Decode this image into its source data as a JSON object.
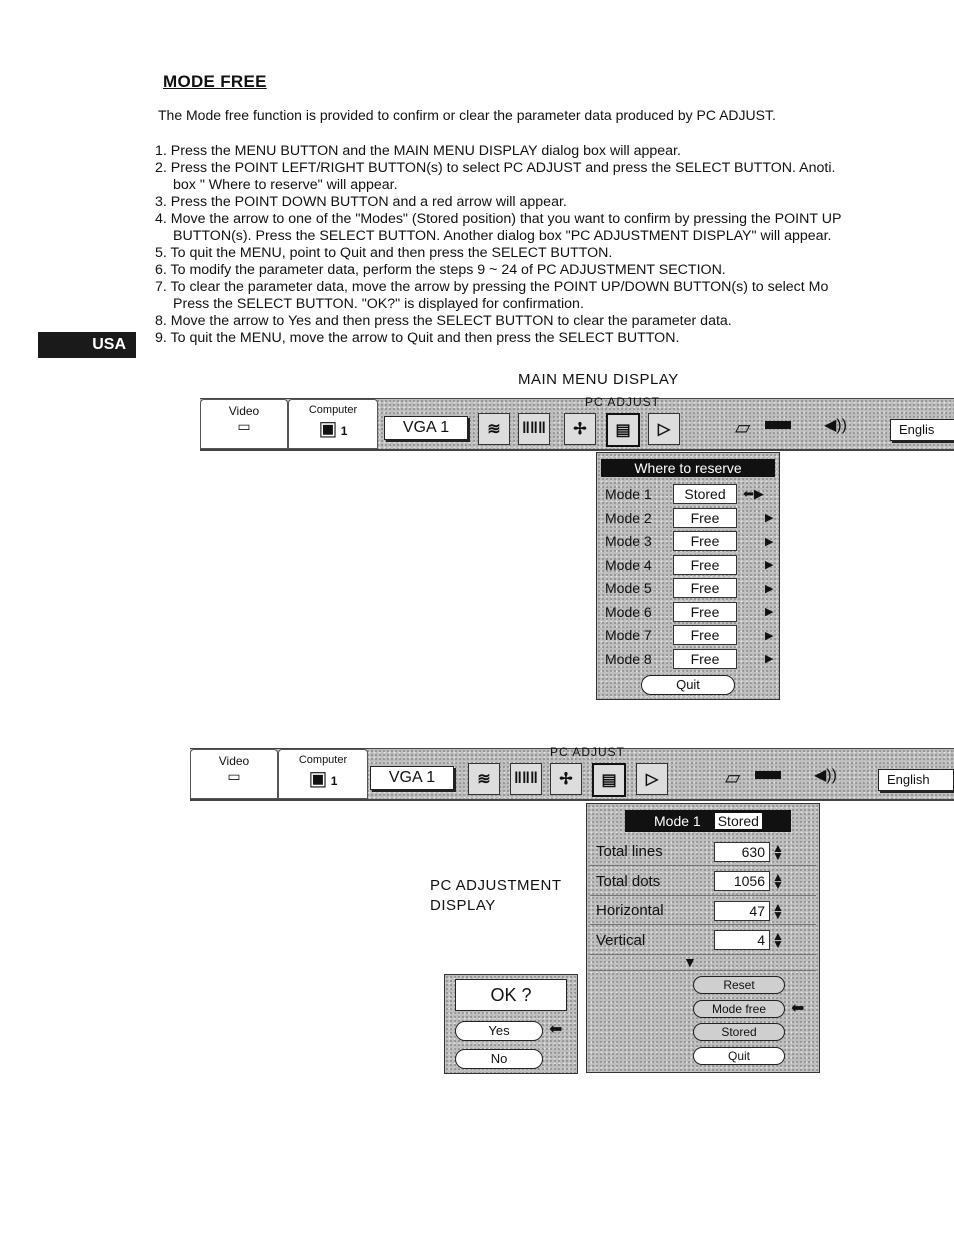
{
  "section": {
    "title": "MODE FREE",
    "intro": "The Mode free function is provided to confirm or clear the parameter data produced by PC ADJUST.",
    "steps": [
      {
        "num": "1.",
        "lines": [
          "Press the MENU BUTTON and the MAIN MENU DISPLAY dialog box will appear."
        ]
      },
      {
        "num": "2.",
        "lines": [
          "Press the POINT LEFT/RIGHT BUTTON(s) to select PC ADJUST and press the SELECT BUTTON. Anoti.",
          "box \" Where to reserve\" will appear."
        ]
      },
      {
        "num": "3.",
        "lines": [
          "Press the POINT DOWN BUTTON and a red arrow will appear."
        ]
      },
      {
        "num": "4.",
        "lines": [
          "Move the arrow to one of the \"Modes\" (Stored position) that you want to confirm by pressing the POINT UP",
          "BUTTON(s). Press the SELECT BUTTON. Another dialog box \"PC ADJUSTMENT DISPLAY\" will appear."
        ]
      },
      {
        "num": "5.",
        "lines": [
          "To quit the MENU, point to Quit and then press the SELECT BUTTON."
        ]
      },
      {
        "num": "6.",
        "lines": [
          "To modify the parameter data, perform the steps 9 ~ 24 of PC ADJUSTMENT SECTION."
        ]
      },
      {
        "num": "7.",
        "lines": [
          "To clear the parameter data, move the arrow by pressing the POINT UP/DOWN BUTTON(s) to select Mo",
          "Press the SELECT BUTTON. \"OK?\" is displayed for confirmation."
        ]
      },
      {
        "num": "8.",
        "lines": [
          "Move the arrow to Yes and then press the SELECT BUTTON to clear the parameter data."
        ]
      },
      {
        "num": "9.",
        "lines": [
          "To quit the MENU, move the arrow to Quit and then press the SELECT BUTTON."
        ]
      }
    ]
  },
  "side_tab": {
    "label": "USA"
  },
  "main_menu": {
    "caption": "MAIN MENU DISPLAY",
    "menubar": {
      "video_tab": "Video",
      "computer_tab": "Computer",
      "computer_index": "1",
      "group_label": "PC ADJUST",
      "source": "VGA 1",
      "language": "Englis"
    },
    "where_to_reserve": {
      "header": "Where to reserve",
      "rows": [
        {
          "label": "Mode 1",
          "value": "Stored",
          "selected": true
        },
        {
          "label": "Mode 2",
          "value": "Free"
        },
        {
          "label": "Mode 3",
          "value": "Free"
        },
        {
          "label": "Mode 4",
          "value": "Free"
        },
        {
          "label": "Mode 5",
          "value": "Free"
        },
        {
          "label": "Mode 6",
          "value": "Free"
        },
        {
          "label": "Mode 7",
          "value": "Free"
        },
        {
          "label": "Mode 8",
          "value": "Free"
        }
      ],
      "quit": "Quit"
    }
  },
  "pc_adjustment": {
    "caption_line1": "PC ADJUSTMENT",
    "caption_line2": "DISPLAY",
    "menubar": {
      "video_tab": "Video",
      "computer_tab": "Computer",
      "computer_index": "1",
      "group_label": "PC ADJUST",
      "source": "VGA 1",
      "language": "English"
    },
    "panel": {
      "mode": "Mode 1",
      "status": "Stored",
      "params": [
        {
          "label": "Total lines",
          "value": "630"
        },
        {
          "label": "Total dots",
          "value": "1056"
        },
        {
          "label": "Horizontal",
          "value": "47"
        },
        {
          "label": "Vertical",
          "value": "4"
        }
      ],
      "buttons": [
        "Reset",
        "Mode free",
        "Stored",
        "Quit"
      ],
      "selected_button": "Mode free"
    },
    "confirm": {
      "prompt": "OK ?",
      "yes": "Yes",
      "no": "No",
      "selected": "Yes"
    }
  },
  "icons": {
    "arrow_left": "⬅",
    "arrow_right": "▶",
    "updown": "⬍",
    "down": "▼",
    "speaker": "◀))",
    "wave": "≋",
    "bars": "‖‖‖",
    "position": "✢",
    "pc": "▤",
    "keystone": "▷"
  }
}
